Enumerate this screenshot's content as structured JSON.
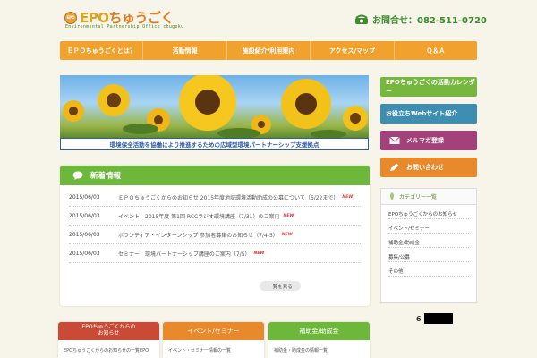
{
  "header": {
    "logo_badge": "EPO",
    "logo_epo": "EPO",
    "logo_kana": "ちゅうごく",
    "logo_sub": "Environmental Partnership Office chugoku",
    "contact": "お問合せ：082-511-0720"
  },
  "nav": {
    "items": [
      "ＥＰＯちゅうごくとは？",
      "活動情報",
      "施設紹介/利用案内",
      "アクセス/マップ",
      "Ｑ＆Ａ"
    ]
  },
  "hero": {
    "caption": "環境保全活動を協働により推進するための広域型環境パートナーシップ支援拠点"
  },
  "news": {
    "title": "新着情報",
    "items": [
      {
        "date": "2015/06/03",
        "text": "ＥＰＯちゅうごくからのお知らせ 2015年度地域環境活動助成の公募について（6/22まで）",
        "badge": "NEW"
      },
      {
        "date": "2015/06/03",
        "text": "イベント　2015年度 第1回 RCCラジオ環境講座（7/31）のご案内",
        "badge": "NEW"
      },
      {
        "date": "2015/06/03",
        "text": "ボランティア・インターンシップ 参加者募集のお知らせ（7/4-5）",
        "badge": "NEW"
      },
      {
        "date": "2015/06/03",
        "text": "セミナー　環境パートナーシップ講座のご案内（7/5）",
        "badge": "NEW"
      }
    ],
    "more": "一覧を見る"
  },
  "sidebar": {
    "calendar": "EPOちゅうごくの活動カレンダー",
    "web": "お役立ちWebサイト紹介",
    "mail": "メルマガ登録",
    "inquiry": "お問い合わせ",
    "category_title": "カテゴリー一覧",
    "categories": [
      "EPOちゅうごくからのお知らせ",
      "イベント/セミナー",
      "補助金/助成金",
      "募集/公募",
      "その他"
    ]
  },
  "counter": {
    "digit": "6"
  },
  "tabs": [
    {
      "label1": "EPOちゅうごくからの",
      "label2": "お知らせ",
      "body": "EPOちゅうごくからのお知らせの一覧EPO"
    },
    {
      "label1": "イベント/セミナー",
      "label2": "",
      "body": "イベント・セミナー情報の一覧"
    },
    {
      "label1": "補助金/助成金",
      "label2": "",
      "body": "補助金・助成金の情報一覧"
    }
  ],
  "colors": {
    "accent_orange": "#f0a12e",
    "accent_green": "#6db73b",
    "calendar_green": "#76b83d",
    "web_blue": "#3d8eb0",
    "mail_purple": "#a3417b",
    "tab_red": "#c94a35"
  }
}
